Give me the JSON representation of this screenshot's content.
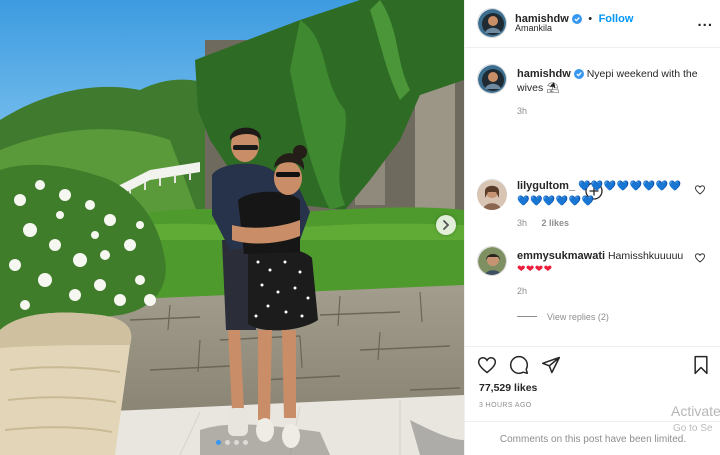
{
  "post": {
    "username": "hamishdw",
    "follow_label": "Follow",
    "separator": "•",
    "location": "Amankila",
    "more": "..."
  },
  "caption": {
    "username": "hamishdw",
    "text": "Nyepi weekend with the wives",
    "emoji": "⛱",
    "time": "3h"
  },
  "comments": [
    {
      "username": "lilygultom_",
      "text": "💙💙💙💙💙💙💙💙💙💙💙💙💙💙",
      "time": "3h",
      "likes": "2 likes"
    },
    {
      "username": "emmysukmawati",
      "text": "Hamisshkuuuuu",
      "hearts": "❤❤❤❤",
      "time": "2h",
      "view_replies": "View replies (2)"
    }
  ],
  "stats": {
    "likes": "77,529 likes",
    "posted": "3 HOURS AGO",
    "comments_limited": "Comments on this post have been limited."
  },
  "overlay": {
    "activate": "Activate",
    "goto": "Go to Se"
  },
  "colors": {
    "accent": "#0095f6",
    "verified": "#3897f0"
  }
}
